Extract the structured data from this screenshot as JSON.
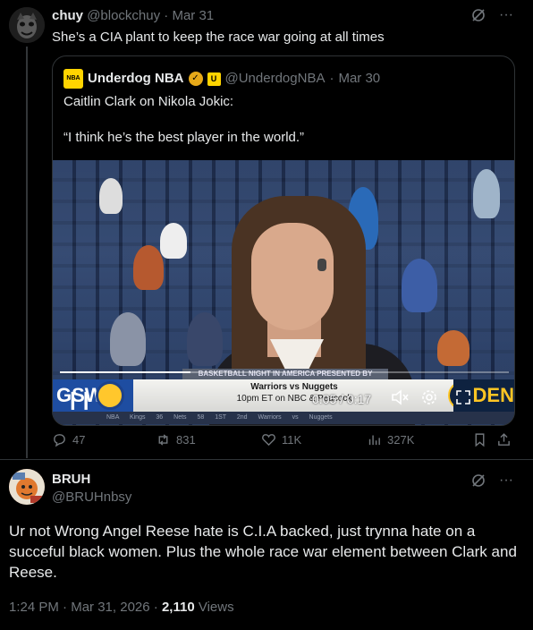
{
  "tweet1": {
    "name": "chuy",
    "handle": "@blockchuy",
    "date": "Mar 31",
    "text": "She’s a CIA plant to keep the race war going at all times",
    "quote": {
      "name": "Underdog NBA",
      "logo_text": "NBA",
      "handle": "@UnderdogNBA",
      "date": "Mar 30",
      "text": "Caitlin Clark on Nikola Jokic:\n\n“I think he’s the best player in the world.”",
      "video": {
        "time": "0:05 / 0:17",
        "progress": 0.29,
        "ticker_title": "BASKETBALL NIGHT IN AMERICA PRESENTED BY McDONALD'S",
        "ticker_matchup": "Warriors vs Nuggets",
        "ticker_time": "10pm ET on NBC & Peacock",
        "team_left": "GSW",
        "team_right": "DEN",
        "ticker_bottom": "NBA  Kings 36  Nets 58  1ST 2nd  Warriors vs Nuggets"
      }
    },
    "actions": {
      "replies": "47",
      "reposts": "831",
      "likes": "11K",
      "views": "327K"
    }
  },
  "tweet2": {
    "name": "BRUH",
    "handle": "@BRUHnbsy",
    "text": "Ur not Wrong Angel Reese hate is C.I.A backed, just trynna hate on a succeful black women. Plus the whole race war element between Clark and Reese.",
    "time": "1:24 PM",
    "date": "Mar 31, 2026",
    "views_count": "2,110",
    "views_label": "Views"
  },
  "colors": {
    "background": "#000000",
    "text": "#e7e9ea",
    "muted": "#71767b",
    "border": "#2f3336",
    "verified_gold": "#e6a919"
  }
}
